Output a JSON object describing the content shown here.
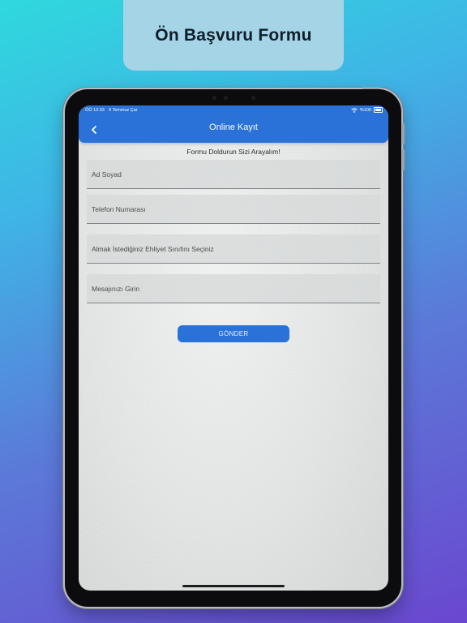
{
  "promo": {
    "title": "Ön Başvuru Formu"
  },
  "status_bar": {
    "time": "ÖÖ 12:33",
    "date": "9 Temmuz Çar",
    "battery": "%100",
    "wifi_icon": "wifi-icon",
    "battery_icon": "battery-icon"
  },
  "nav": {
    "title": "Online Kayıt",
    "back_icon": "chevron-left-icon"
  },
  "form": {
    "heading": "Formu Doldurun Sizi Arayalım!",
    "fields": [
      {
        "placeholder": "Ad Soyad",
        "value": ""
      },
      {
        "placeholder": "Telefon Numarası",
        "value": ""
      },
      {
        "placeholder": "Almak İstediğiniz Ehliyet Sınıfını Seçiniz",
        "value": ""
      },
      {
        "placeholder": "Mesajınızı Girin",
        "value": ""
      }
    ],
    "submit_label": "GÖNDER"
  },
  "colors": {
    "primary": "#2a72d8",
    "promo_box": "#a5d4e6",
    "background_top": "#2fd9dd",
    "background_bottom": "#6a47cf"
  }
}
